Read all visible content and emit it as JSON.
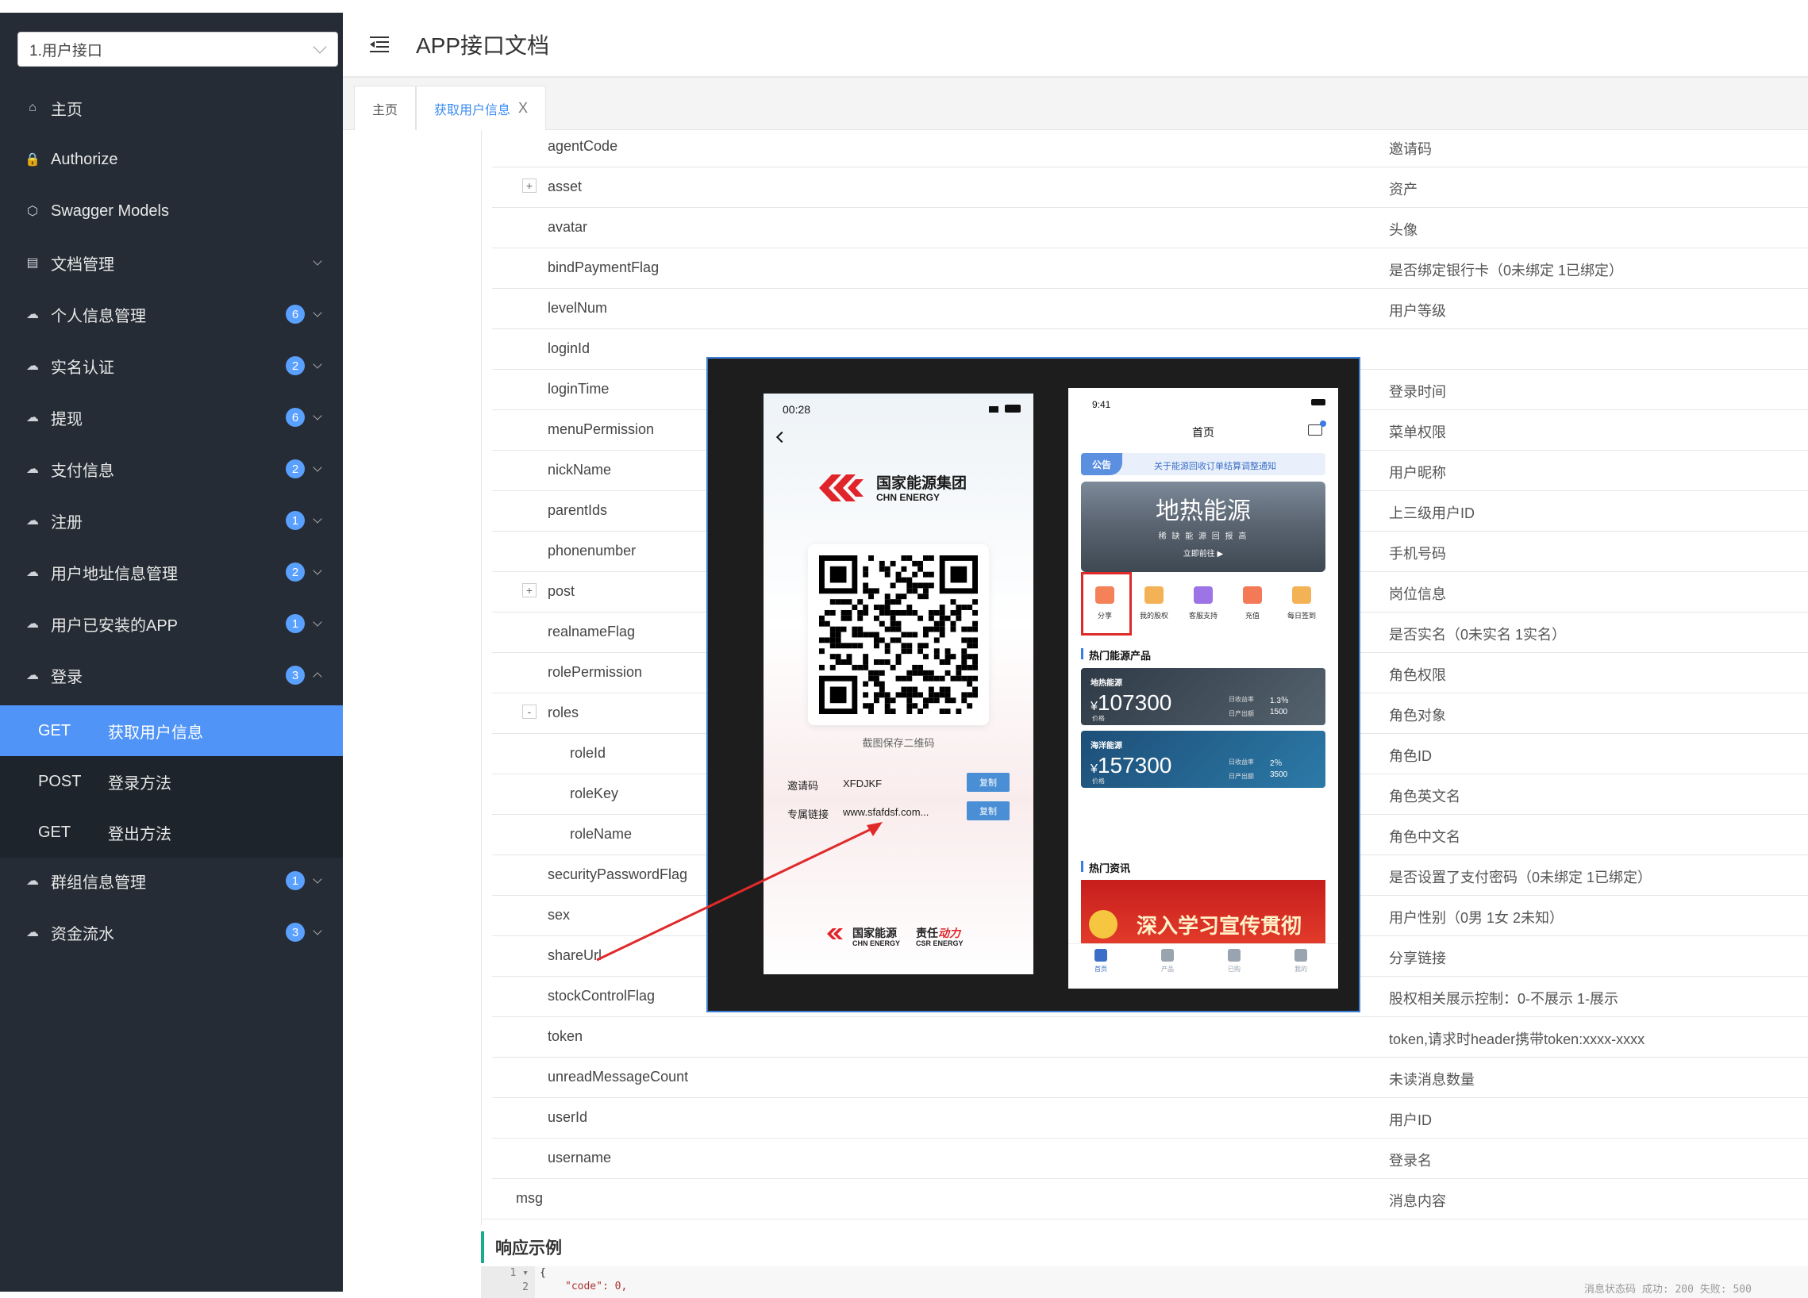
{
  "sidebar": {
    "selector_value": "1.用户接口",
    "items": [
      {
        "label": "主页",
        "icon": "home-icon"
      },
      {
        "label": "Authorize",
        "icon": "lock-icon"
      },
      {
        "label": "Swagger Models",
        "icon": "cube-icon"
      },
      {
        "label": "文档管理",
        "icon": "doc-icon"
      },
      {
        "label": "个人信息管理",
        "badge": "6"
      },
      {
        "label": "实名认证",
        "badge": "2"
      },
      {
        "label": "提现",
        "badge": "6"
      },
      {
        "label": "支付信息",
        "badge": "2"
      },
      {
        "label": "注册",
        "badge": "1"
      },
      {
        "label": "用户地址信息管理",
        "badge": "2"
      },
      {
        "label": "用户已安装的APP",
        "badge": "1"
      },
      {
        "label": "登录",
        "badge": "3"
      }
    ],
    "sub_items": [
      {
        "method": "GET",
        "name": "获取用户信息"
      },
      {
        "method": "POST",
        "name": "登录方法"
      },
      {
        "method": "GET",
        "name": "登出方法"
      }
    ],
    "items_after": [
      {
        "label": "群组信息管理",
        "badge": "1"
      },
      {
        "label": "资金流水",
        "badge": "3"
      }
    ]
  },
  "header": {
    "title": "APP接口文档"
  },
  "tabs": [
    {
      "label": "主页"
    },
    {
      "label": "获取用户信息",
      "close": "X"
    }
  ],
  "rows": [
    {
      "name": "agentCode",
      "desc": "邀请码"
    },
    {
      "name": "asset",
      "desc": "资产",
      "expand": "+"
    },
    {
      "name": "avatar",
      "desc": "头像"
    },
    {
      "name": "bindPaymentFlag",
      "desc": "是否绑定银行卡（0未绑定 1已绑定）"
    },
    {
      "name": "levelNum",
      "desc": "用户等级"
    },
    {
      "name": "loginId",
      "desc": ""
    },
    {
      "name": "loginTime",
      "desc": "登录时间"
    },
    {
      "name": "menuPermission",
      "desc": "菜单权限"
    },
    {
      "name": "nickName",
      "desc": "用户昵称"
    },
    {
      "name": "parentIds",
      "desc": "上三级用户ID"
    },
    {
      "name": "phonenumber",
      "desc": "手机号码"
    },
    {
      "name": "post",
      "desc": "岗位信息",
      "expand": "+"
    },
    {
      "name": "realnameFlag",
      "desc": "是否实名（0未实名 1实名）"
    },
    {
      "name": "rolePermission",
      "desc": "角色权限"
    },
    {
      "name": "roles",
      "desc": "角色对象",
      "expand": "-"
    },
    {
      "name": "roleId",
      "desc": "角色ID",
      "indent": true
    },
    {
      "name": "roleKey",
      "desc": "角色英文名",
      "indent": true
    },
    {
      "name": "roleName",
      "desc": "角色中文名",
      "indent": true
    },
    {
      "name": "securityPasswordFlag",
      "desc": "是否设置了支付密码（0未绑定 1已绑定）"
    },
    {
      "name": "sex",
      "desc": "用户性别（0男 1女 2未知）"
    },
    {
      "name": "shareUrl",
      "desc": "分享链接"
    },
    {
      "name": "stockControlFlag",
      "desc": "股权相关展示控制：0-不展示 1-展示"
    },
    {
      "name": "token",
      "desc": "token,请求时header携带token:xxxx-xxxx"
    },
    {
      "name": "unreadMessageCount",
      "desc": "未读消息数量"
    },
    {
      "name": "userId",
      "desc": "用户ID"
    },
    {
      "name": "username",
      "desc": "登录名"
    },
    {
      "name": "msg",
      "desc": "消息内容",
      "top": true
    }
  ],
  "response": {
    "title": "响应示例",
    "line1_no": "1",
    "line2_no": "2",
    "line1": "{",
    "line2": "\"code\": 0,",
    "comment": "消息状态码  成功: 200  失败: 500"
  },
  "phone1": {
    "time": "00:28",
    "brand_cn": "国家能源集团",
    "brand_en": "CHN ENERGY",
    "qr_caption": "截图保存二维码",
    "invite_label": "邀请码",
    "invite_value": "XFDJKF",
    "link_label": "专属链接",
    "link_value": "www.sfafdsf.com...",
    "copy": "复制",
    "footer_cn1": "国家能源",
    "footer_en1": "CHN ENERGY",
    "footer_cn2": "责任",
    "footer_cn2b": "动力",
    "footer_en2": "CSR ENERGY"
  },
  "phone2": {
    "time": "9:41",
    "title": "首页",
    "notice_tag": "公告",
    "notice": "关于能源回收订单结算调整通知",
    "banner_title": "地热能源",
    "banner_sub": "稀 缺 能 源  回 报 高",
    "banner_cta": "立即前往 ▶",
    "icons": [
      "分享",
      "我的股权",
      "客服支持",
      "充值",
      "每日签到"
    ],
    "section1": "热门能源产品",
    "cards": [
      {
        "tag": "地热能源",
        "price": "107300",
        "price_label": "价格",
        "rate_label": "日收益率",
        "rate": "1.3％",
        "out_label": "日产出额",
        "out": "1500"
      },
      {
        "tag": "海洋能源",
        "price": "157300",
        "price_label": "价格",
        "rate_label": "日收益率",
        "rate": "2％",
        "out_label": "日产出额",
        "out": "3500"
      }
    ],
    "yen": "¥",
    "section2": "热门资讯",
    "news_banner": "深入学习宣传贯彻",
    "tabbar": [
      "首页",
      "产品",
      "已购",
      "我的"
    ]
  }
}
